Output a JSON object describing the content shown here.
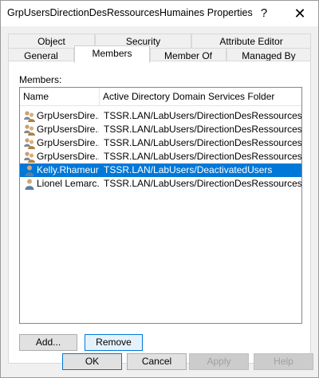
{
  "window": {
    "title": "GrpUsersDirectionDesRessourcesHumaines Properties",
    "help_glyph": "?",
    "close_glyph": "✕"
  },
  "tabs": {
    "row_back": [
      "Object",
      "Security",
      "Attribute Editor"
    ],
    "row_front": [
      "General",
      "Members",
      "Member Of",
      "Managed By"
    ],
    "active": "Members"
  },
  "members": {
    "label": "Members:",
    "columns": [
      "Name",
      "Active Directory Domain Services Folder"
    ],
    "rows": [
      {
        "icon": "group-icon",
        "name": "GrpUsersDire...",
        "folder": "TSSR.LAN/LabUsers/DirectionDesRessources..."
      },
      {
        "icon": "group-icon",
        "name": "GrpUsersDire...",
        "folder": "TSSR.LAN/LabUsers/DirectionDesRessources..."
      },
      {
        "icon": "group-icon",
        "name": "GrpUsersDire...",
        "folder": "TSSR.LAN/LabUsers/DirectionDesRessources..."
      },
      {
        "icon": "group-icon",
        "name": "GrpUsersDire...",
        "folder": "TSSR.LAN/LabUsers/DirectionDesRessources..."
      },
      {
        "icon": "user-icon",
        "name": "Kelly.Rhameur",
        "folder": "TSSR.LAN/LabUsers/DeactivatedUsers",
        "selected": true
      },
      {
        "icon": "user-icon",
        "name": "Lionel Lemarc...",
        "folder": "TSSR.LAN/LabUsers/DirectionDesRessources..."
      }
    ]
  },
  "buttons": {
    "add": "Add...",
    "remove": "Remove",
    "ok": "OK",
    "cancel": "Cancel",
    "apply": "Apply",
    "help": "Help"
  },
  "colors": {
    "selection": "#0078d7",
    "dialog_bg": "#f0f0f0"
  }
}
